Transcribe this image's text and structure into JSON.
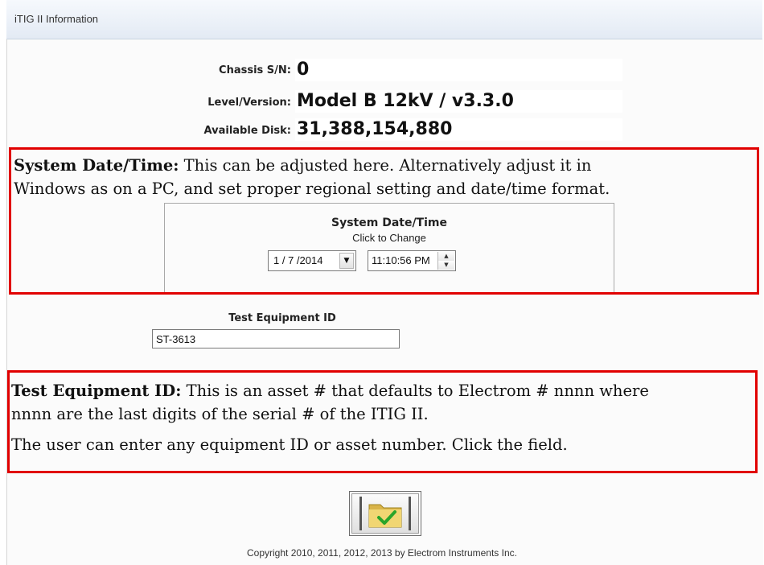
{
  "window": {
    "title": "iTIG II Information"
  },
  "info": {
    "chassis_label": "Chassis S/N:",
    "chassis_value": "0",
    "level_label": "Level/Version:",
    "level_value": "Model B 12kV / v3.3.0",
    "disk_label": "Available Disk:",
    "disk_value": "31,388,154,880"
  },
  "annotation_datetime": {
    "heading": "System Date/Time:",
    "line1": " This can be adjusted here. Alternatively adjust it in",
    "line2": "Windows as on a PC, and set proper regional setting and date/time format."
  },
  "datetime_group": {
    "title": "System Date/Time",
    "subtitle": "Click to Change",
    "date_value": "1 / 7 /2014",
    "time_value": "11:10:56 PM"
  },
  "test_equipment": {
    "label": "Test Equipment ID",
    "value": "ST-3613"
  },
  "annotation_teid": {
    "heading": "Test Equipment ID:",
    "line1": " This is an asset # that defaults to Electrom # nnnn where",
    "line2": "nnnn are the last digits of the serial # of the ITIG II.",
    "line3": "The user can enter any equipment ID or asset number. Click the field."
  },
  "footer": {
    "ok_icon": "folder-check-icon",
    "copyright": "Copyright 2010, 2011, 2012, 2013 by Electrom Instruments Inc."
  },
  "colors": {
    "annotation_border": "#e10000",
    "check_green": "#2aa52a",
    "folder_yellow": "#e8c85a"
  }
}
